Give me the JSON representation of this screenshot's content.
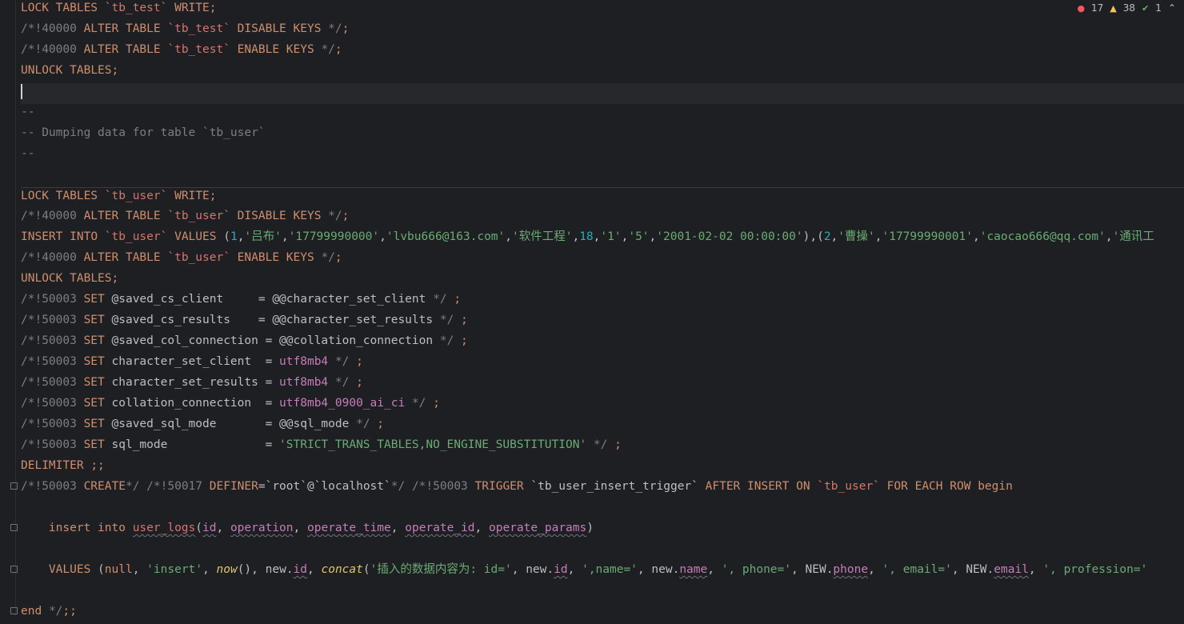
{
  "inspections": {
    "errors": "17",
    "warnings": "38",
    "weak": "1",
    "chevron": "⌃"
  },
  "lines": [
    [
      "LOCK TABLES `tb_test` WRITE;"
    ],
    [
      "/*!40000 ALTER TABLE `tb_test` DISABLE KEYS */;"
    ],
    [
      "/*!40000 ALTER TABLE `tb_test` ENABLE KEYS */;"
    ],
    [
      "UNLOCK TABLES;"
    ],
    [
      ""
    ],
    [
      "--"
    ],
    [
      "-- Dumping data for table `tb_user`"
    ],
    [
      "--"
    ],
    [
      ""
    ],
    [
      "LOCK TABLES `tb_user` WRITE;"
    ],
    [
      "/*!40000 ALTER TABLE `tb_user` DISABLE KEYS */;"
    ],
    [
      "INSERT INTO `tb_user` VALUES (1,'吕布','17799990000','lvbu666@163.com','软件工程',18,'1','5','2001-02-02 00:00:00'),(2,'曹操','17799990001','caocao666@qq.com','通讯工"
    ],
    [
      "/*!40000 ALTER TABLE `tb_user` ENABLE KEYS */;"
    ],
    [
      "UNLOCK TABLES;"
    ],
    [
      "/*!50003 SET @saved_cs_client     = @@character_set_client */ ;"
    ],
    [
      "/*!50003 SET @saved_cs_results    = @@character_set_results */ ;"
    ],
    [
      "/*!50003 SET @saved_col_connection = @@collation_connection */ ;"
    ],
    [
      "/*!50003 SET character_set_client  = utf8mb4 */ ;"
    ],
    [
      "/*!50003 SET character_set_results = utf8mb4 */ ;"
    ],
    [
      "/*!50003 SET collation_connection  = utf8mb4_0900_ai_ci */ ;"
    ],
    [
      "/*!50003 SET @saved_sql_mode       = @@sql_mode */ ;"
    ],
    [
      "/*!50003 SET sql_mode              = 'STRICT_TRANS_TABLES,NO_ENGINE_SUBSTITUTION' */ ;"
    ],
    [
      "DELIMITER ;;"
    ],
    [
      "/*!50003 CREATE*/ /*!50017 DEFINER=`root`@`localhost`*/ /*!50003 TRIGGER `tb_user_insert_trigger` AFTER INSERT ON `tb_user` FOR EACH ROW begin"
    ],
    [
      ""
    ],
    [
      "    insert into user_logs(id, operation, operate_time, operate_id, operate_params)"
    ],
    [
      ""
    ],
    [
      "    VALUES (null, 'insert', now(), new.id, concat('插入的数据内容为: id=', new.id, ',name=', new.name, ', phone=', NEW.phone, ', email=', NEW.email, ', profession='"
    ],
    [
      ""
    ],
    [
      "end */;;"
    ]
  ]
}
